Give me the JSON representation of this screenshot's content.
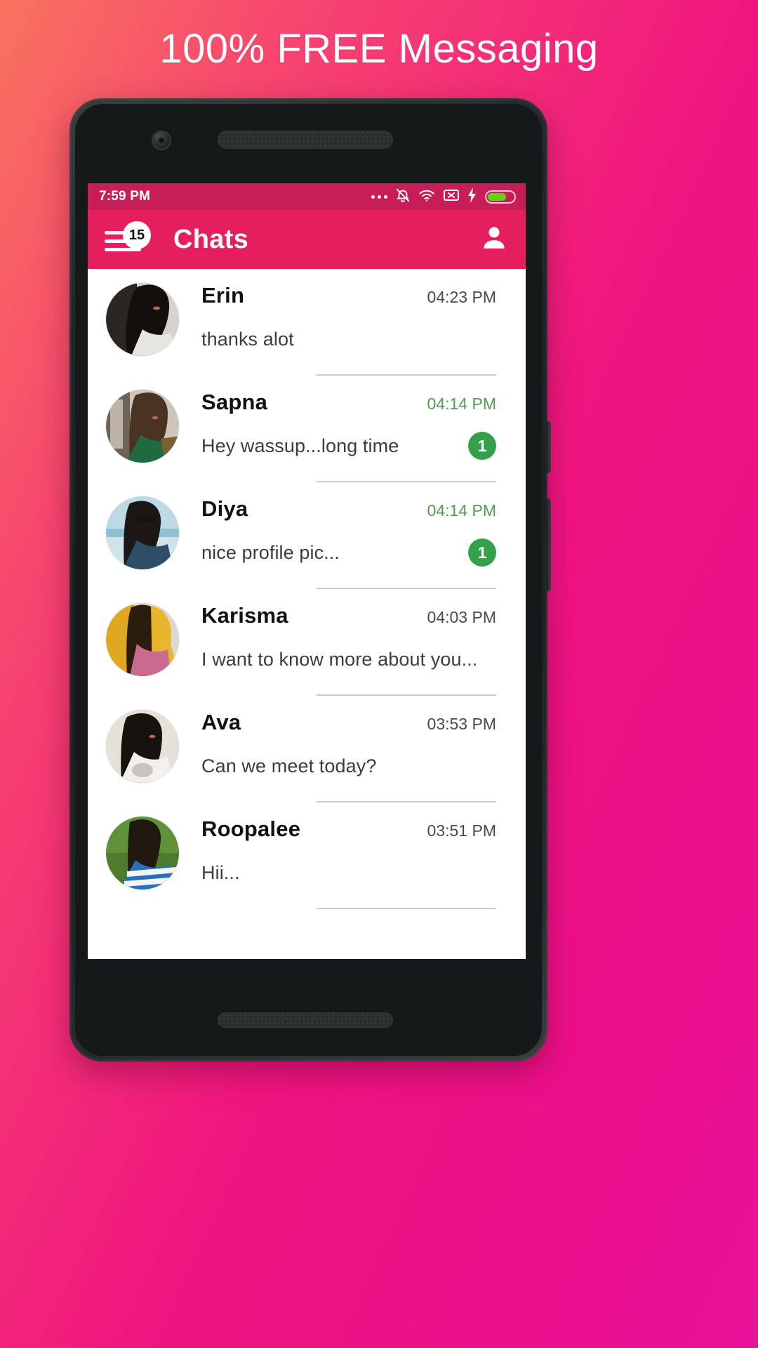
{
  "promo": {
    "headline": "100% FREE Messaging"
  },
  "theme": {
    "background_gradient_start": "#f8735e",
    "background_gradient_end": "#e8119a",
    "appbar_color": "#e51f5e",
    "statusbar_color": "#c81d56",
    "unread_accent": "#34a14a",
    "unread_time_color": "#4f9c52"
  },
  "statusbar": {
    "time": "7:59 PM",
    "icons": [
      "more-dots-icon",
      "bell-muted-icon",
      "wifi-icon",
      "no-sim-icon",
      "charging-bolt-icon",
      "battery-icon"
    ],
    "battery_level_percent": 72
  },
  "appbar": {
    "menu_icon": "hamburger-menu-icon",
    "menu_badge_count": "15",
    "title": "Chats",
    "profile_icon": "person-icon"
  },
  "chats": [
    {
      "name": "Erin",
      "time": "04:23 PM",
      "message": "thanks alot",
      "unread": "",
      "has_unread": false
    },
    {
      "name": "Sapna",
      "time": "04:14 PM",
      "message": "Hey wassup...long time",
      "unread": "1",
      "has_unread": true
    },
    {
      "name": "Diya",
      "time": "04:14 PM",
      "message": "nice profile pic...",
      "unread": "1",
      "has_unread": true
    },
    {
      "name": "Karisma",
      "time": "04:03 PM",
      "message": "I want to know more about you...",
      "unread": "",
      "has_unread": false
    },
    {
      "name": "Ava",
      "time": "03:53 PM",
      "message": "Can we meet today?",
      "unread": "",
      "has_unread": false
    },
    {
      "name": "Roopalee",
      "time": "03:51 PM",
      "message": "Hii...",
      "unread": "",
      "has_unread": false
    }
  ]
}
